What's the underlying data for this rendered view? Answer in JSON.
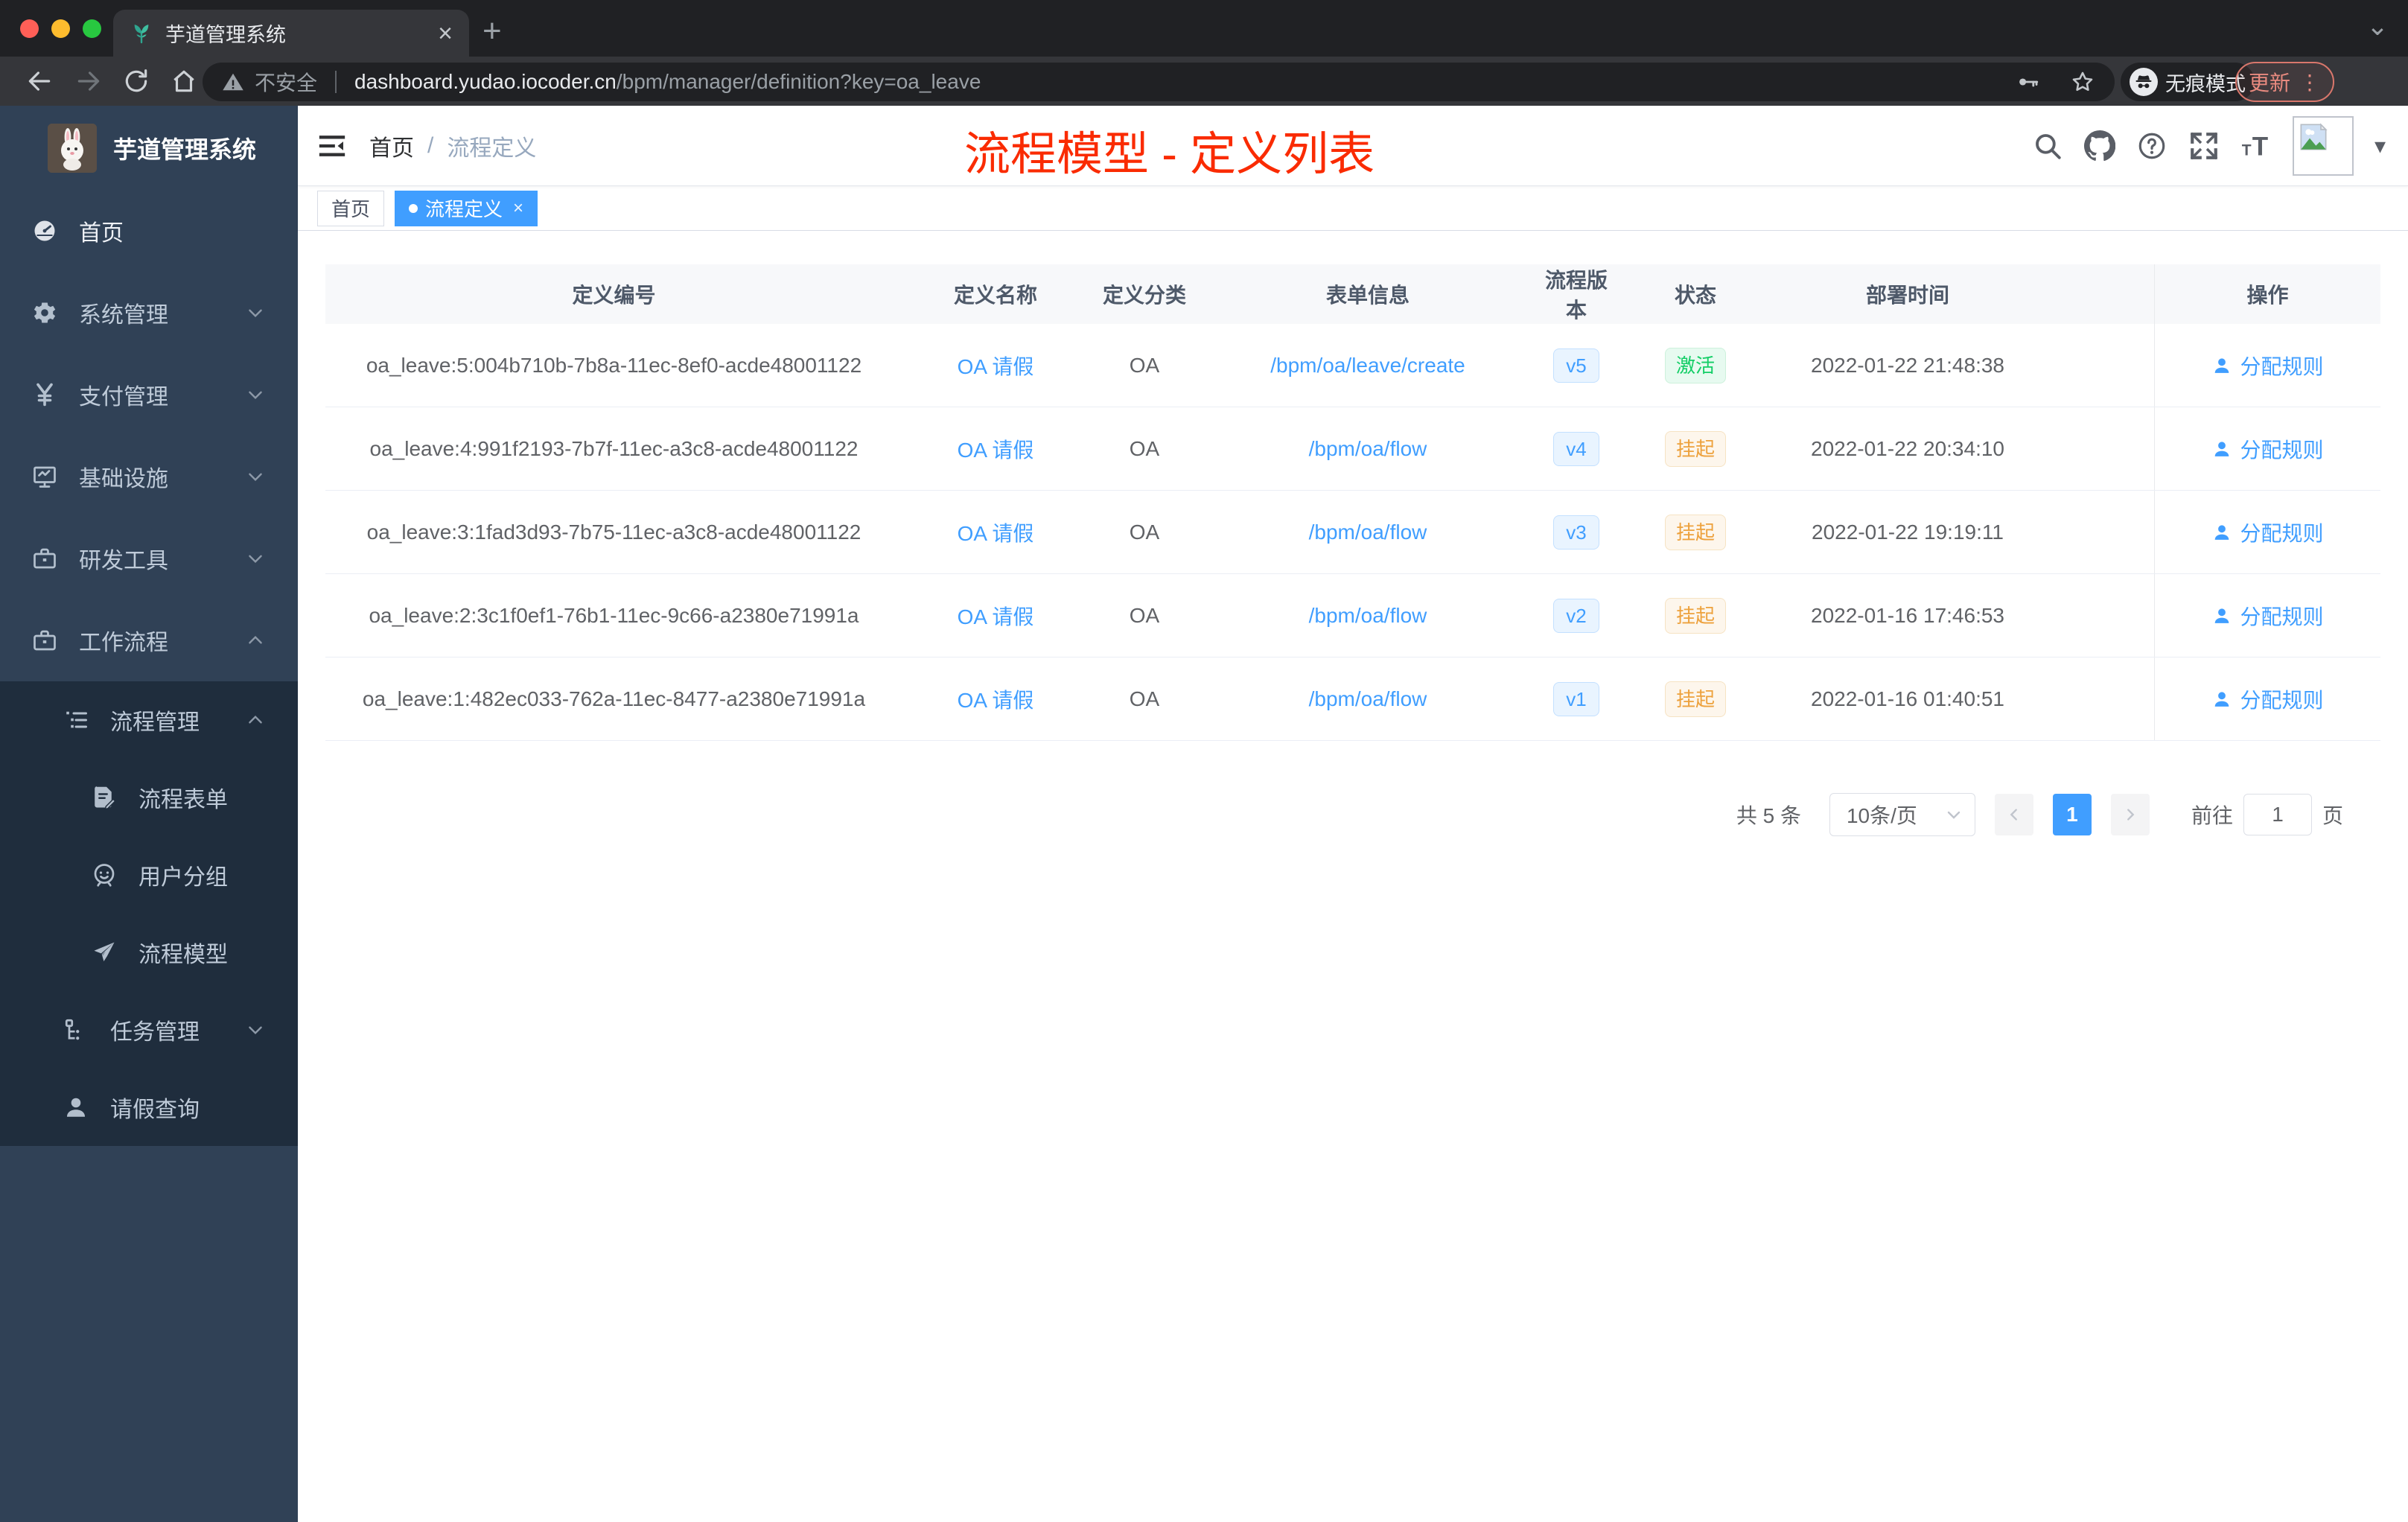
{
  "browser": {
    "tab_title": "芋道管理系统",
    "security_label": "不安全",
    "url_domain": "dashboard.yudao.iocoder.cn",
    "url_path": "/bpm/manager/definition?key=oa_leave",
    "incognito_label": "无痕模式",
    "update_label": "更新"
  },
  "icons": {
    "close": "×",
    "plus": "+",
    "caret": "⌄",
    "dots": "⋮",
    "nav_caret": "▾"
  },
  "sidebar": {
    "app_title": "芋道管理系统",
    "items": [
      {
        "name": "home",
        "label": "首页",
        "icon": "gauge",
        "level": 1,
        "chevron": null,
        "dark": false,
        "bright": true
      },
      {
        "name": "system-mgmt",
        "label": "系统管理",
        "icon": "gear",
        "level": 1,
        "chevron": "down",
        "dark": false,
        "bright": false
      },
      {
        "name": "payment-mgmt",
        "label": "支付管理",
        "icon": "yen",
        "level": 1,
        "chevron": "down",
        "dark": false,
        "bright": false
      },
      {
        "name": "infrastructure",
        "label": "基础设施",
        "icon": "monitor",
        "level": 1,
        "chevron": "down",
        "dark": false,
        "bright": false
      },
      {
        "name": "dev-tools",
        "label": "研发工具",
        "icon": "briefcase",
        "level": 1,
        "chevron": "down",
        "dark": false,
        "bright": false
      },
      {
        "name": "workflow",
        "label": "工作流程",
        "icon": "briefcase",
        "level": 1,
        "chevron": "up",
        "dark": false,
        "bright": false
      },
      {
        "name": "process-mgmt",
        "label": "流程管理",
        "icon": "listtree",
        "level": 2,
        "chevron": "up",
        "dark": true,
        "bright": false
      },
      {
        "name": "process-form",
        "label": "流程表单",
        "icon": "docedit",
        "level": 3,
        "chevron": null,
        "dark": true,
        "bright": false
      },
      {
        "name": "user-group",
        "label": "用户分组",
        "icon": "face",
        "level": 3,
        "chevron": null,
        "dark": true,
        "bright": false
      },
      {
        "name": "process-model",
        "label": "流程模型",
        "icon": "plane",
        "level": 3,
        "chevron": null,
        "dark": true,
        "bright": false
      },
      {
        "name": "task-mgmt",
        "label": "任务管理",
        "icon": "tree",
        "level": 2,
        "chevron": "down",
        "dark": true,
        "bright": false
      },
      {
        "name": "leave-query",
        "label": "请假查询",
        "icon": "person",
        "level": 2,
        "chevron": null,
        "dark": true,
        "bright": false
      }
    ]
  },
  "header": {
    "breadcrumb": [
      "首页",
      "流程定义"
    ],
    "annotation": "流程模型 - 定义列表"
  },
  "tags": [
    {
      "label": "首页",
      "active": false
    },
    {
      "label": "流程定义",
      "active": true
    }
  ],
  "table": {
    "columns": [
      "定义编号",
      "定义名称",
      "定义分类",
      "表单信息",
      "流程版本",
      "状态",
      "部署时间",
      "操作"
    ],
    "rows": [
      {
        "id": "oa_leave:5:004b710b-7b8a-11ec-8ef0-acde48001122",
        "name": "OA 请假",
        "category": "OA",
        "form": "/bpm/oa/leave/create",
        "version": "v5",
        "status": "激活",
        "status_type": "success",
        "deploy_time": "2022-01-22 21:48:38",
        "action": "分配规则"
      },
      {
        "id": "oa_leave:4:991f2193-7b7f-11ec-a3c8-acde48001122",
        "name": "OA 请假",
        "category": "OA",
        "form": "/bpm/oa/flow",
        "version": "v4",
        "status": "挂起",
        "status_type": "warning",
        "deploy_time": "2022-01-22 20:34:10",
        "action": "分配规则"
      },
      {
        "id": "oa_leave:3:1fad3d93-7b75-11ec-a3c8-acde48001122",
        "name": "OA 请假",
        "category": "OA",
        "form": "/bpm/oa/flow",
        "version": "v3",
        "status": "挂起",
        "status_type": "warning",
        "deploy_time": "2022-01-22 19:19:11",
        "action": "分配规则"
      },
      {
        "id": "oa_leave:2:3c1f0ef1-76b1-11ec-9c66-a2380e71991a",
        "name": "OA 请假",
        "category": "OA",
        "form": "/bpm/oa/flow",
        "version": "v2",
        "status": "挂起",
        "status_type": "warning",
        "deploy_time": "2022-01-16 17:46:53",
        "action": "分配规则"
      },
      {
        "id": "oa_leave:1:482ec033-762a-11ec-8477-a2380e71991a",
        "name": "OA 请假",
        "category": "OA",
        "form": "/bpm/oa/flow",
        "version": "v1",
        "status": "挂起",
        "status_type": "warning",
        "deploy_time": "2022-01-16 01:40:51",
        "action": "分配规则"
      }
    ]
  },
  "pagination": {
    "total_label": "共 5 条",
    "page_size": "10条/页",
    "current_page": "1",
    "goto_label": "前往",
    "goto_value": "1",
    "page_unit": "页"
  },
  "colors": {
    "accent_blue": "#409eff",
    "annotation_red": "#fa2b01",
    "status_active_green": "#13ce66",
    "status_suspend_yellow": "#eda13c",
    "sidebar_bg": "#304156",
    "submenu_bg": "#1f2d3d"
  }
}
